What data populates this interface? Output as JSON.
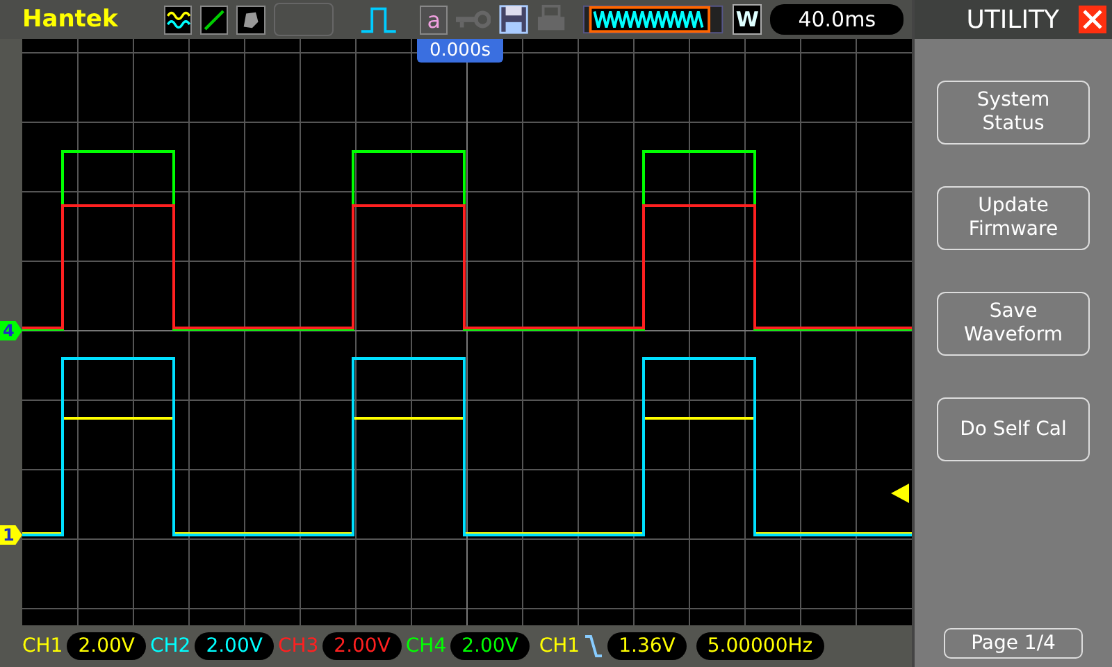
{
  "toolbar": {
    "logo": "Hantek",
    "text_icon": "a",
    "window_mode": "W",
    "timebase": "40.0ms"
  },
  "screen": {
    "time_offset": "0.000s",
    "channel_markers": [
      {
        "label": "4",
        "color": "#00ff00",
        "kind": "ch4"
      },
      {
        "label": "1",
        "color": "#ffff00",
        "kind": "ch1"
      }
    ]
  },
  "menu": {
    "title": "UTILITY",
    "buttons": [
      {
        "lines": [
          "System",
          "Status"
        ]
      },
      {
        "lines": [
          "Update",
          "Firmware"
        ]
      },
      {
        "lines": [
          "Save",
          "Waveform"
        ]
      },
      {
        "lines": [
          "Do Self Cal"
        ]
      }
    ],
    "page": "Page 1/4"
  },
  "status_bar": {
    "channels": [
      {
        "label": "CH1",
        "scale": "2.00V",
        "color": "#ffff00"
      },
      {
        "label": "CH2",
        "scale": "2.00V",
        "color": "#00ffff"
      },
      {
        "label": "CH3",
        "scale": "2.00V",
        "color": "#ff2020"
      },
      {
        "label": "CH4",
        "scale": "2.00V",
        "color": "#00ff00"
      }
    ],
    "trigger": {
      "source": "CH1",
      "level": "1.36V",
      "frequency": "5.00000Hz"
    }
  }
}
